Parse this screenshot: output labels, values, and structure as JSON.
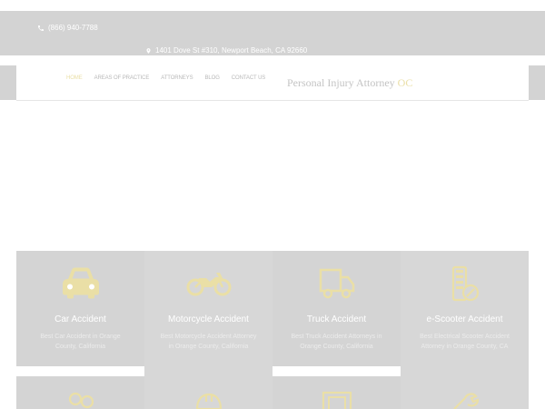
{
  "topbar": {
    "phone": "(866) 940-7788",
    "address": "1401 Dove St #310, Newport Beach, CA 92660"
  },
  "nav": {
    "items": [
      {
        "label": "HOME",
        "active": true
      },
      {
        "label": "AREAS OF PRACTICE",
        "active": false
      },
      {
        "label": "ATTORNEYS",
        "active": false
      },
      {
        "label": "BLOG",
        "active": false
      },
      {
        "label": "CONTACT US",
        "active": false
      }
    ],
    "brand_main": "Personal Injury Attorney",
    "brand_accent": "OC"
  },
  "services": [
    {
      "title": "Car Accident",
      "desc": "Best Car Accident in Orange County, California",
      "icon": "car-icon"
    },
    {
      "title": "Motorcycle Accident",
      "desc": "Best Motorcycle Accident Attorney in Orange County, California",
      "icon": "motorcycle-icon"
    },
    {
      "title": "Truck Accident",
      "desc": "Best Truck Accident Attorneys in Orange County, California",
      "icon": "truck-icon"
    },
    {
      "title": "e-Scooter Accident",
      "desc": "Best Electrical Scooter Accident Attorney in Orange County, CA",
      "icon": "scooter-battery-icon"
    }
  ],
  "services_row2_icons": [
    "people-icon",
    "hard-hat-icon",
    "picture-frame-icon",
    "wrench-icon"
  ],
  "colors": {
    "accent": "#EADFA6",
    "card_bg": "#D4D4D4",
    "topbar_bg": "#D3D3D3"
  }
}
